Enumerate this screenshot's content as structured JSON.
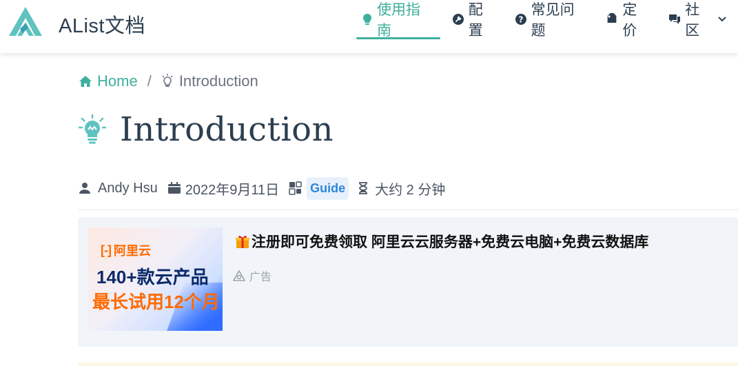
{
  "site": {
    "title": "AList文档",
    "accent": "#3eaf9e"
  },
  "nav": {
    "items": [
      {
        "label": "使用指南",
        "icon": "lightbulb-icon",
        "active": true
      },
      {
        "label": "配置",
        "icon": "wrench-circle-icon"
      },
      {
        "label": "常见问题",
        "icon": "question-circle-icon"
      },
      {
        "label": "定价",
        "icon": "tag-icon"
      },
      {
        "label": "社区",
        "icon": "chat-bubbles-icon",
        "dropdown": true
      }
    ]
  },
  "breadcrumb": {
    "home": "Home",
    "separator": "/",
    "current": "Introduction"
  },
  "page": {
    "title": "Introduction"
  },
  "meta": {
    "author": "Andy Hsu",
    "date": "2022年9月11日",
    "category": "Guide",
    "reading_time": "大约 2 分钟"
  },
  "ad": {
    "image": {
      "brand": "阿里云",
      "line1": "140+款云产品",
      "line2": "最长试用12个月"
    },
    "title": "注册即可免费领取 阿里云云服务器+免费云电脑+免费云数据库",
    "label": "广告"
  }
}
